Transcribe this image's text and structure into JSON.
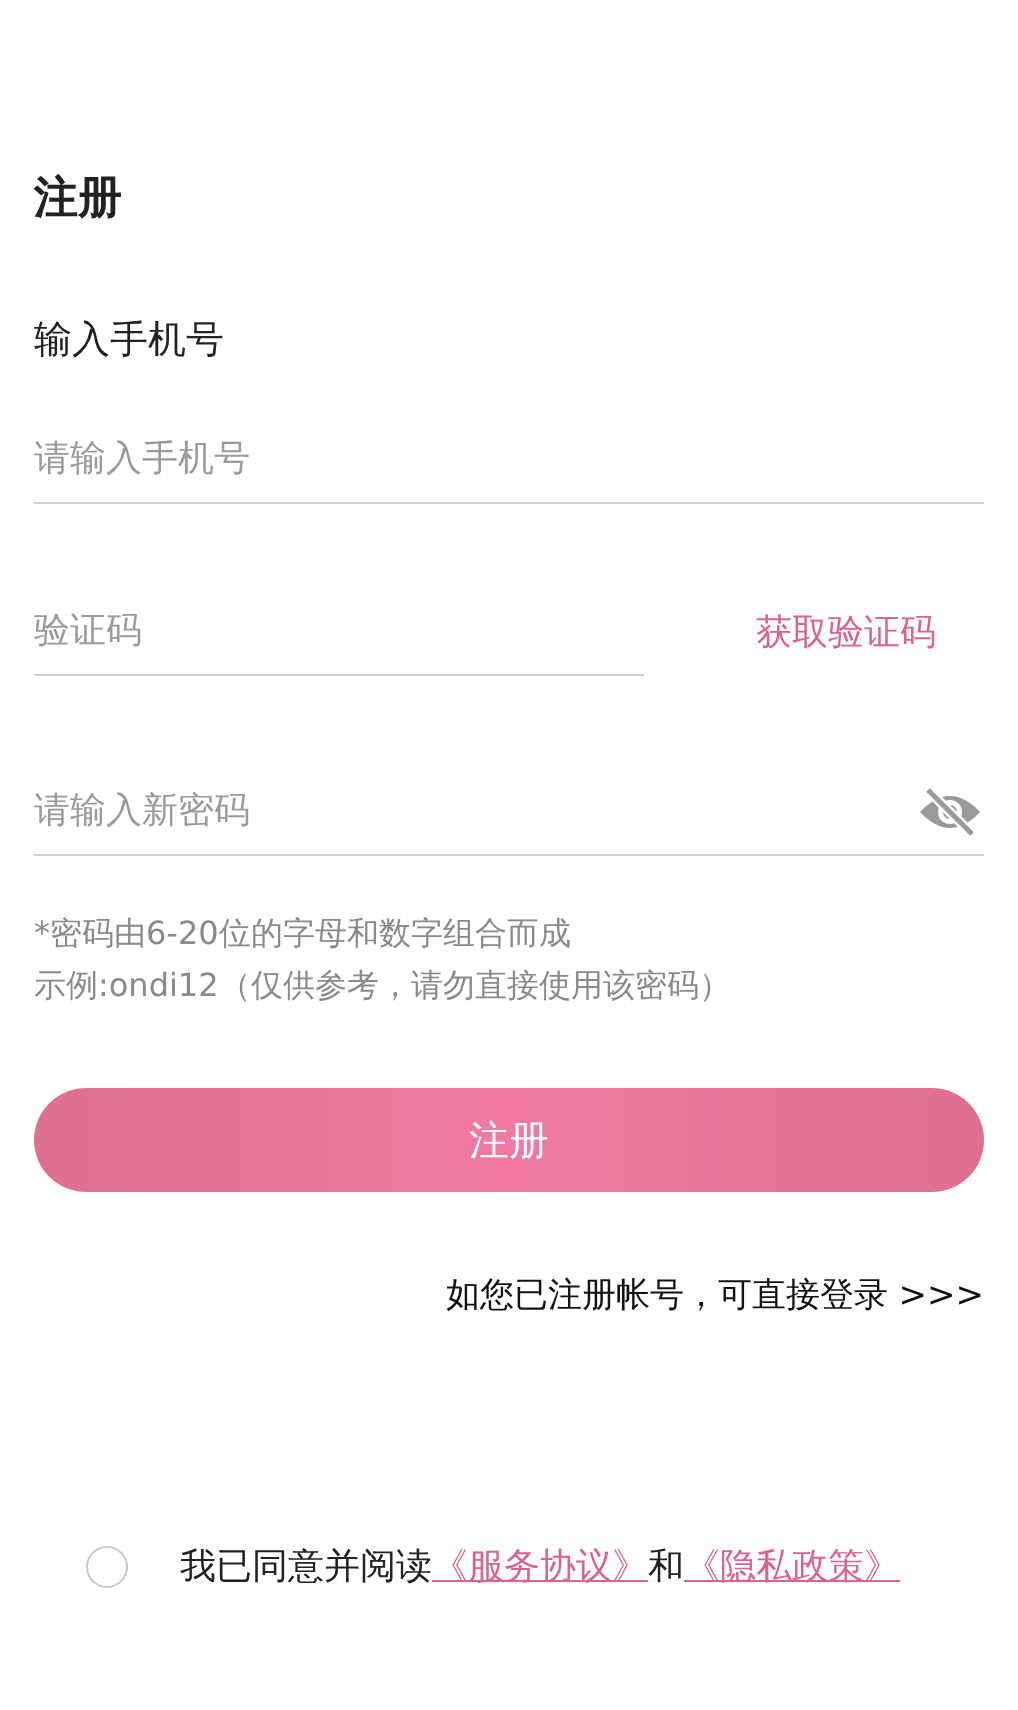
{
  "title": "注册",
  "phone_label": "输入手机号",
  "phone": {
    "placeholder": "请输入手机号"
  },
  "code": {
    "placeholder": "验证码"
  },
  "get_code": "获取验证码",
  "password": {
    "placeholder": "请输入新密码",
    "visible": false
  },
  "hints": [
    "*密码由6-20位的字母和数字组合而成",
    "示例:ondi12（仅供参考，请勿直接使用该密码）"
  ],
  "submit": "注册",
  "login_link": "如您已注册帐号，可直接登录 >>>",
  "agreement": {
    "checked": false,
    "text": "我已同意并阅读",
    "links": [
      "《服务协议》",
      "《隐私政策》"
    ],
    "joiner": "和"
  }
}
